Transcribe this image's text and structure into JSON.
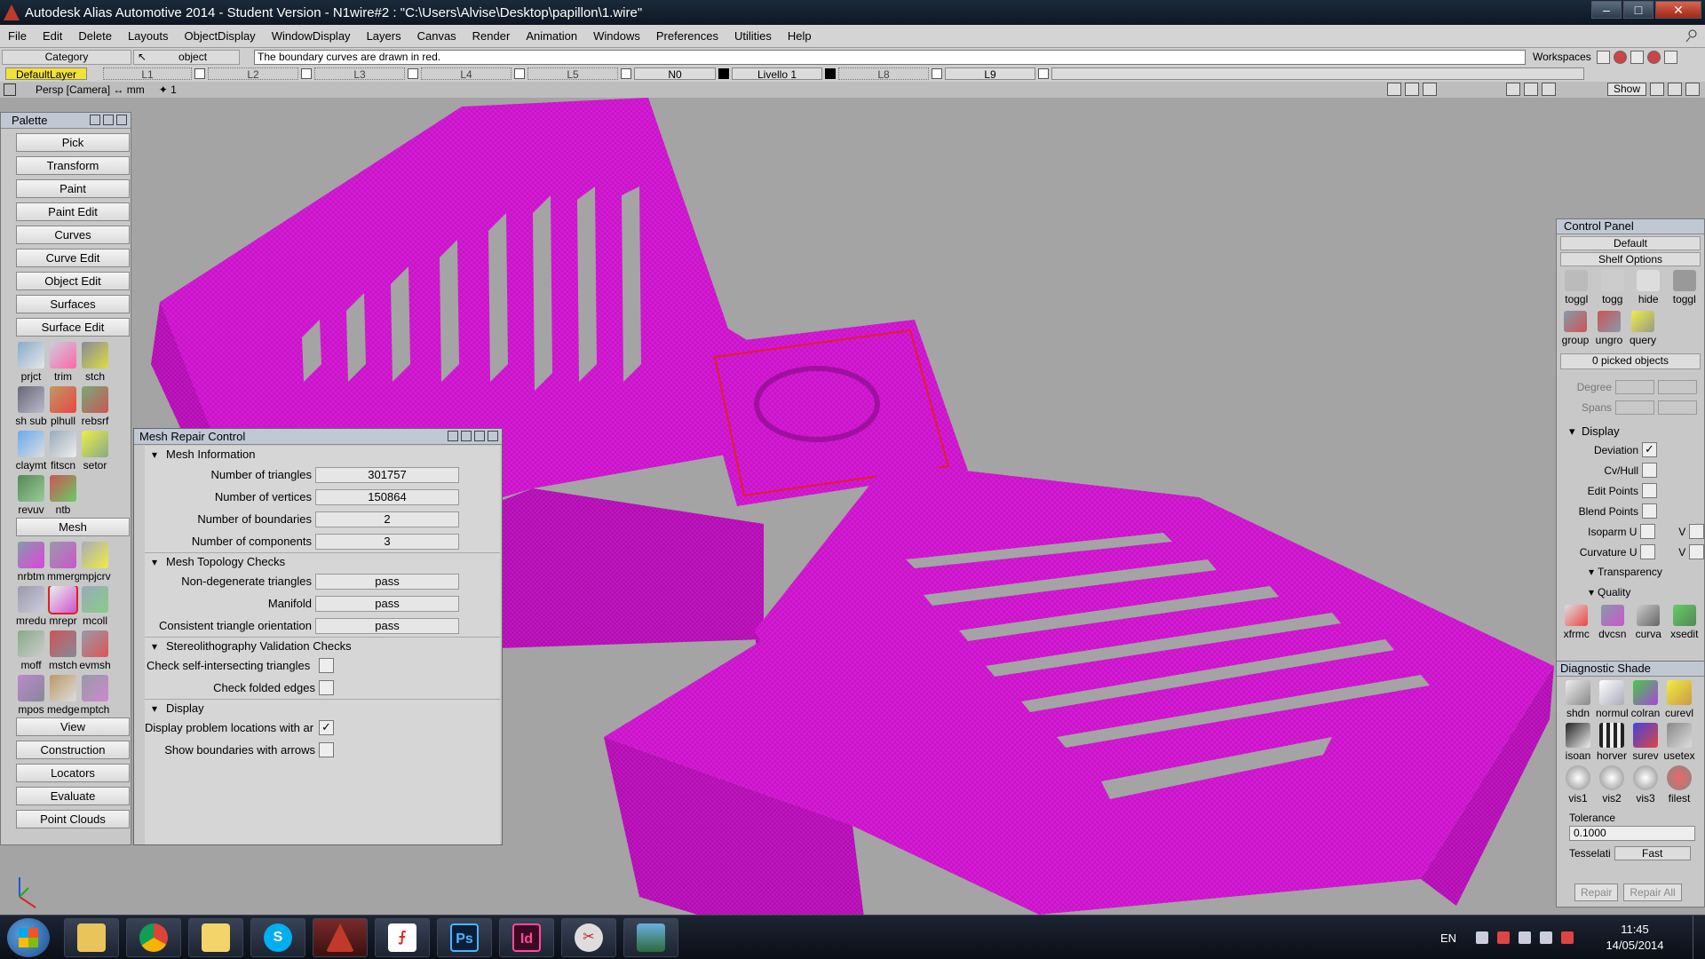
{
  "window": {
    "title": "Autodesk Alias Automotive 2014   - Student Version   - N1wire#2 : \"C:\\Users\\Alvise\\Desktop\\papillon\\1.wire\""
  },
  "menu": [
    "File",
    "Edit",
    "Delete",
    "Layouts",
    "ObjectDisplay",
    "WindowDisplay",
    "Layers",
    "Canvas",
    "Render",
    "Animation",
    "Windows",
    "Preferences",
    "Utilities",
    "Help"
  ],
  "prompt": {
    "category": "Category",
    "object": "object",
    "message": "The boundary curves are drawn in red.",
    "workspaces": "Workspaces"
  },
  "layers": {
    "default": "DefaultLayer",
    "items": [
      "L1",
      "L2",
      "L3",
      "L4",
      "L5",
      "N0",
      "Livello 1",
      "L8",
      "L9"
    ]
  },
  "view": {
    "label": "Persp [Camera] ↔ mm",
    "grid": "✦ 1",
    "show": "Show"
  },
  "palette": {
    "title": "Palette",
    "buttons_top": [
      "Pick",
      "Transform",
      "Paint",
      "Paint Edit",
      "Curves",
      "Curve Edit",
      "Object Edit",
      "Surfaces",
      "Surface Edit"
    ],
    "surface_tools": [
      "prjct",
      "trim",
      "stch",
      "sh sub",
      "plhull",
      "rebsrf",
      "claymt",
      "fitscn",
      "setor",
      "revuv",
      "ntb"
    ],
    "mesh_label": "Mesh",
    "mesh_tools": [
      "nrbtm",
      "mmerg",
      "mpjcrv",
      "mredu",
      "mrepr",
      "mcoll",
      "moff",
      "mstch",
      "evmsh",
      "mpos",
      "medge",
      "mptch"
    ],
    "buttons_bottom": [
      "View",
      "Construction",
      "Locators",
      "Evaluate",
      "Point Clouds"
    ]
  },
  "mesh_repair": {
    "title": "Mesh Repair Control",
    "info_section": "Mesh Information",
    "info_rows": [
      {
        "label": "Number of triangles",
        "value": "301757"
      },
      {
        "label": "Number of vertices",
        "value": "150864"
      },
      {
        "label": "Number of boundaries",
        "value": "2"
      },
      {
        "label": "Number of components",
        "value": "3"
      }
    ],
    "topology_section": "Mesh Topology Checks",
    "topology_rows": [
      {
        "label": "Non-degenerate triangles",
        "value": "pass"
      },
      {
        "label": "Manifold",
        "value": "pass"
      },
      {
        "label": "Consistent triangle orientation",
        "value": "pass"
      }
    ],
    "stl_section": "Stereolithography Validation Checks",
    "stl_checks": [
      {
        "label": "Check self-intersecting triangles",
        "checked": false
      },
      {
        "label": "Check folded edges",
        "checked": false
      }
    ],
    "display_section": "Display",
    "display_checks": [
      {
        "label": "Display problem locations with ar",
        "checked": true
      },
      {
        "label": "Show boundaries with arrows",
        "checked": false
      }
    ]
  },
  "control_panel": {
    "title": "Control Panel",
    "preset": "Default",
    "shelf_options": "Shelf Options",
    "shelf_tools": [
      "toggl",
      "togg",
      "hide",
      "toggl",
      "group",
      "ungro",
      "query"
    ],
    "picked": "0 picked objects",
    "degree_label": "Degree",
    "spans_label": "Spans",
    "display_section": "Display",
    "display_rows": [
      {
        "label": "Deviation",
        "checked": true
      },
      {
        "label": "Cv/Hull",
        "checked": false
      },
      {
        "label": "Edit Points",
        "checked": false
      },
      {
        "label": "Blend Points",
        "checked": false
      },
      {
        "label": "Isoparm U",
        "checked": false,
        "v": "V"
      },
      {
        "label": "Curvature U",
        "checked": false,
        "v": "V"
      }
    ],
    "transparency": "Transparency",
    "quality": "Quality",
    "bottom_tools": [
      "xfrmc",
      "dvcsn",
      "curva",
      "xsedit"
    ]
  },
  "diagnostic": {
    "title": "Diagnostic Shade",
    "tools": [
      "shdn",
      "normul",
      "colran",
      "curevl",
      "isoan",
      "horver",
      "surev",
      "usetex",
      "vis1",
      "vis2",
      "vis3",
      "filest"
    ],
    "tolerance_label": "Tolerance",
    "tolerance_value": "0.1000",
    "tessellation_label": "Tesselati",
    "tessellation_value": "Fast",
    "repair": "Repair",
    "repair_all": "Repair All"
  },
  "taskbar": {
    "apps": [
      "explorer",
      "chrome",
      "folder",
      "skype",
      "alias",
      "acrobat",
      "photoshop",
      "indesign",
      "snipping",
      "photos"
    ],
    "lang": "EN",
    "time": "11:45",
    "date": "14/05/2014"
  },
  "colors": {
    "mesh": "#d81ad8",
    "boundary": "#e0202a",
    "titlebar": "#0e1722"
  }
}
